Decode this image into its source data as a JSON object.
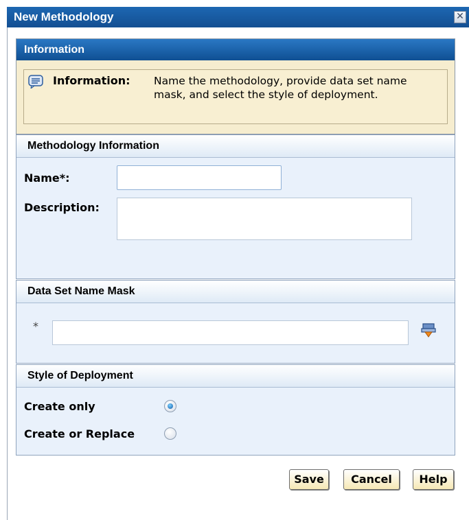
{
  "dialog": {
    "title": "New Methodology",
    "close_glyph": "✕"
  },
  "information": {
    "header": "Information",
    "label": "Information:",
    "text": "Name the methodology, provide data set name mask, and select the style of deployment."
  },
  "methodology_info": {
    "header": "Methodology Information",
    "name_label": "Name*:",
    "name_value": "",
    "description_label": "Description:",
    "description_value": ""
  },
  "data_set_mask": {
    "header": "Data Set Name Mask",
    "required_marker": "*",
    "value": ""
  },
  "deployment": {
    "header": "Style of Deployment",
    "options": [
      {
        "label": "Create only",
        "selected": true
      },
      {
        "label": "Create or Replace",
        "selected": false
      }
    ]
  },
  "buttons": {
    "save": "Save",
    "cancel": "Cancel",
    "help": "Help"
  },
  "colors": {
    "titlebar": "#134f92",
    "info_background": "#f6edcf",
    "panel_background": "#e9f1fb",
    "button_gradient_end": "#f6e8b4"
  },
  "icons": {
    "info": "speech-bubble-icon",
    "mask_tool": "lookup-tool-icon",
    "close": "close-icon"
  }
}
